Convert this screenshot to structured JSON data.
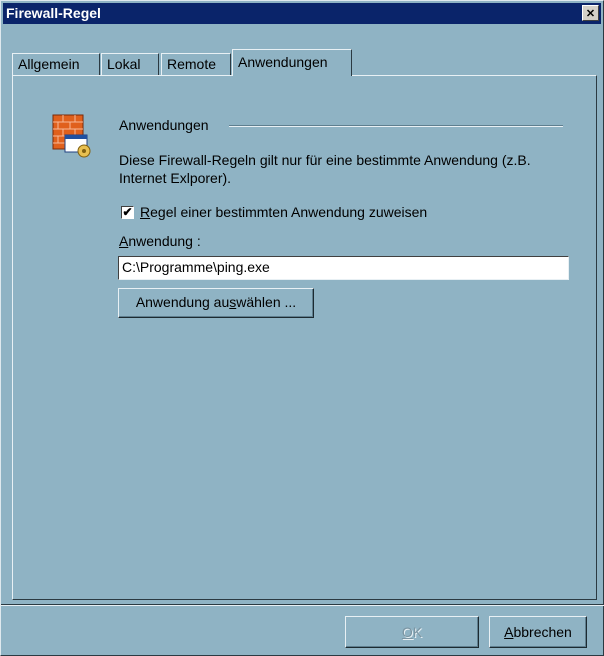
{
  "window": {
    "title": "Firewall-Regel"
  },
  "titlebar": {
    "close_glyph": "✕"
  },
  "tabs": [
    {
      "label": "Allgemein"
    },
    {
      "label": "Lokal"
    },
    {
      "label": "Remote"
    },
    {
      "label": "Anwendungen",
      "active": true
    }
  ],
  "section": {
    "title": "Anwendungen",
    "description": "Diese Firewall-Regeln gilt nur für eine bestimmte Anwendung (z.B. Internet Exlporer)."
  },
  "checkbox": {
    "label_prefix": "",
    "label_mnemonic": "R",
    "label_rest": "egel einer bestimmten Anwendung zuweisen",
    "checked": true,
    "check_glyph": "✔"
  },
  "field": {
    "label_mnemonic": "A",
    "label_rest": "nwendung :",
    "value": "C:\\Programme\\ping.exe"
  },
  "select_button": {
    "label_prefix": "Anwendung au",
    "label_mnemonic": "s",
    "label_rest": "wählen ..."
  },
  "buttons": {
    "ok": {
      "label_mnemonic": "O",
      "label_rest": "K",
      "enabled": false
    },
    "cancel": {
      "label_mnemonic": "A",
      "label_rest": "bbrechen"
    }
  },
  "colors": {
    "background": "#8fb3c4",
    "titlebar": "#0a246a",
    "accent_icon": "#e0601c"
  }
}
